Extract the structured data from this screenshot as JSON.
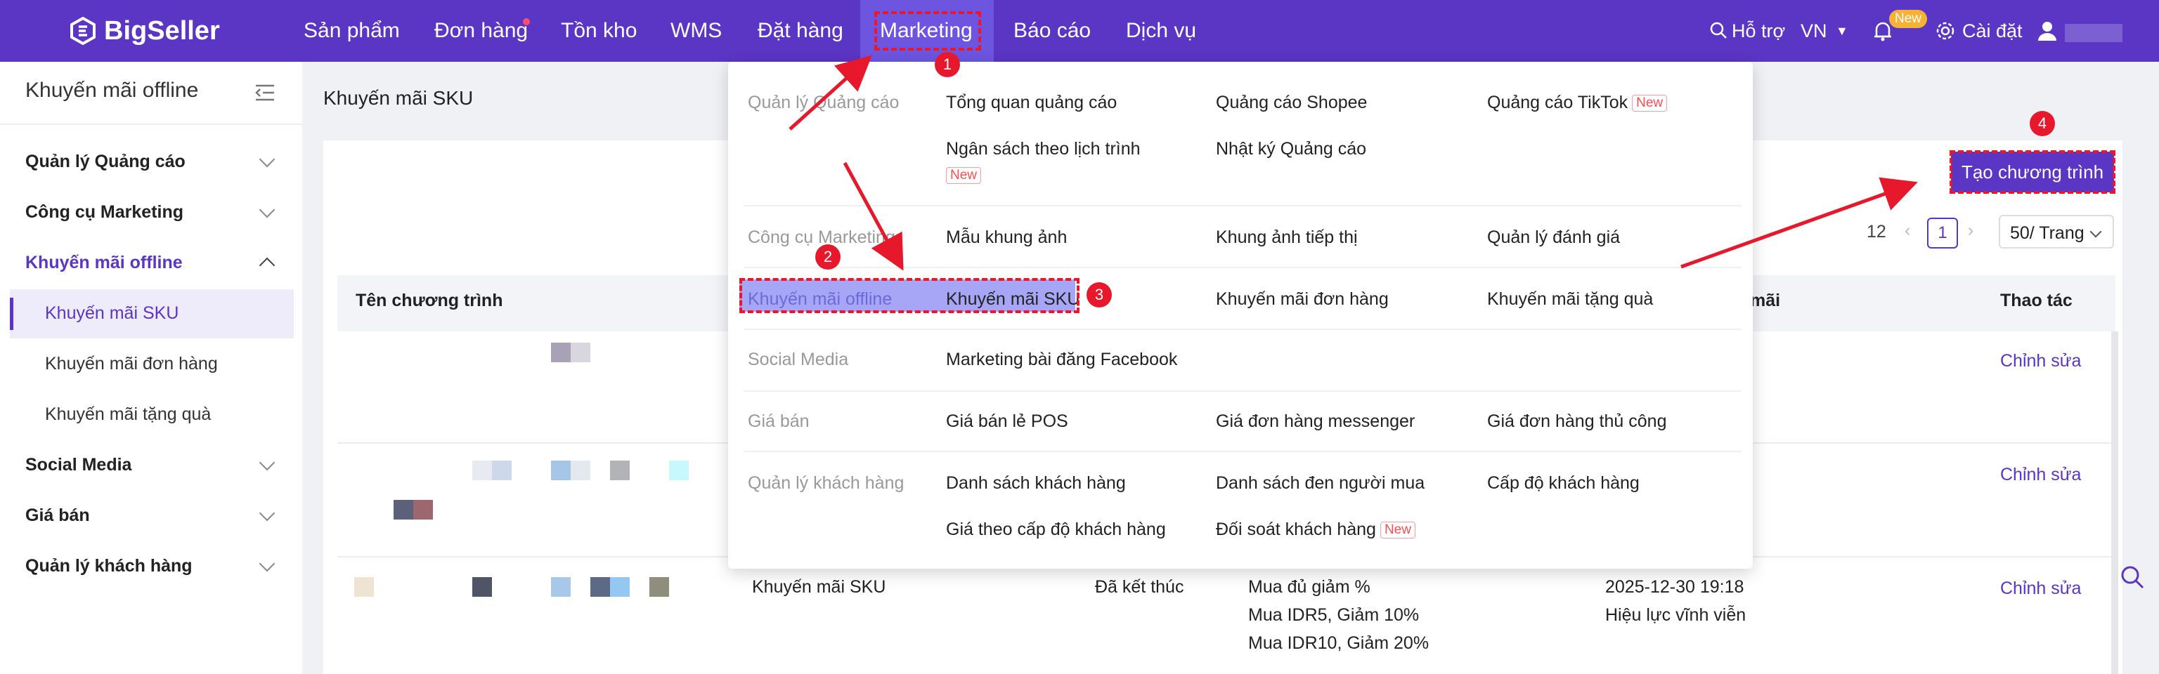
{
  "topbar": {
    "brand": "BigSeller",
    "nav": [
      "Sản phẩm",
      "Đơn hàng",
      "Tồn kho",
      "WMS",
      "Đặt hàng",
      "Marketing",
      "Báo cáo",
      "Dịch vụ"
    ],
    "help": "Hỗ trợ",
    "language": "VN",
    "new_badge": "New",
    "settings": "Cài đặt",
    "colors": {
      "bar": "#5b35c4",
      "accent": "#6d55e0",
      "alert": "#e8182c"
    }
  },
  "sidebar": {
    "title": "Khuyến mãi offline",
    "groups": [
      "Quản lý Quảng cáo",
      "Công cụ Marketing",
      "Khuyến mãi offline",
      "Social Media",
      "Giá bán",
      "Quản lý khách hàng"
    ],
    "sub_items": [
      "Khuyến mãi SKU",
      "Khuyến mãi đơn hàng",
      "Khuyến mãi tặng quà"
    ]
  },
  "page": {
    "title": "Khuyến mãi SKU",
    "create_button": "Tạo chương trình",
    "pagination": {
      "total": "12",
      "current": "1",
      "page_size": "50/ Trang"
    },
    "columns": {
      "name": "Tên chương trình",
      "period_suffix": "mãi",
      "actions": "Thao tác"
    },
    "edit_label": "Chỉnh sửa",
    "row3": {
      "type": "Khuyến mãi SKU",
      "status": "Đã kết thúc",
      "rule_title": "Mua đủ giảm %",
      "rule_1": "Mua IDR5, Giảm 10%",
      "rule_2": "Mua IDR10, Giảm 20%",
      "end_time": "2025-12-30 19:18",
      "validity": "Hiệu lực vĩnh viễn"
    }
  },
  "dropdown": {
    "new_tag": "New",
    "sections": [
      {
        "category": "Quản lý Quảng cáo",
        "items": [
          "Tổng quan quảng cáo",
          "Quảng cáo Shopee",
          "Quảng cáo TikTok",
          "Ngân sách theo lịch trình",
          "Nhật ký Quảng cáo"
        ]
      },
      {
        "category": "Công cụ Marketing",
        "items": [
          "Mẫu khung ảnh",
          "Khung ảnh tiếp thị",
          "Quản lý đánh giá"
        ]
      },
      {
        "category": "Khuyến mãi offline",
        "items": [
          "Khuyến mãi SKU",
          "Khuyến mãi đơn hàng",
          "Khuyến mãi tặng quà"
        ]
      },
      {
        "category": "Social Media",
        "items": [
          "Marketing bài đăng Facebook"
        ]
      },
      {
        "category": "Giá bán",
        "items": [
          "Giá bán lẻ POS",
          "Giá đơn hàng messenger",
          "Giá đơn hàng thủ công"
        ]
      },
      {
        "category": "Quản lý khách hàng",
        "items": [
          "Danh sách khách hàng",
          "Danh sách đen người mua",
          "Cấp độ khách hàng",
          "Giá theo cấp độ khách hàng",
          "Đối soát khách hàng"
        ]
      }
    ]
  },
  "annotations": {
    "steps": [
      "1",
      "2",
      "3",
      "4"
    ]
  }
}
